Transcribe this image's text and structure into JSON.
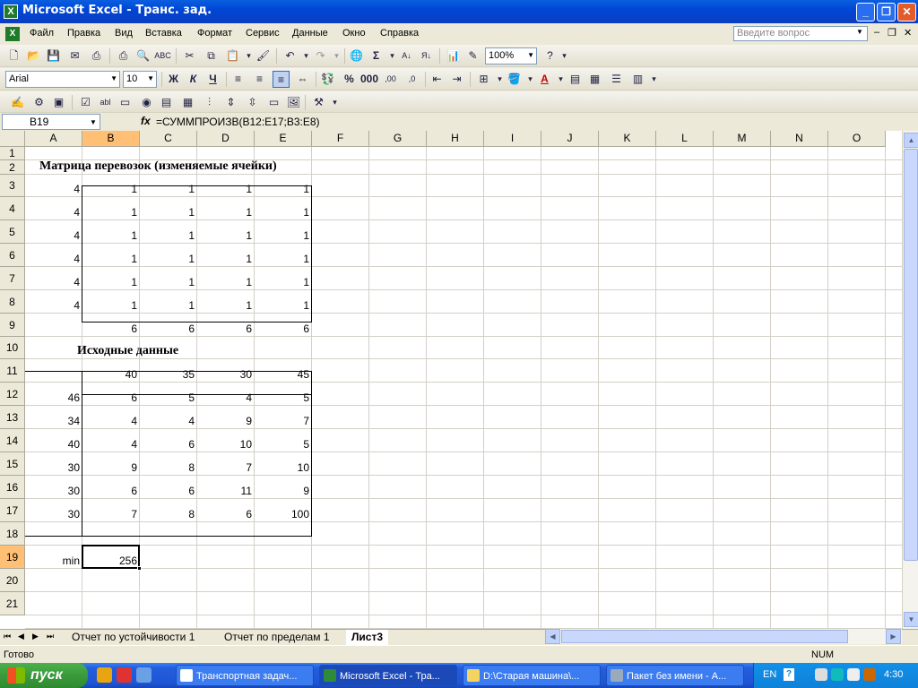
{
  "window": {
    "title": "Microsoft Excel - Транс. зад."
  },
  "menu": [
    "Файл",
    "Правка",
    "Вид",
    "Вставка",
    "Формат",
    "Сервис",
    "Данные",
    "Окно",
    "Справка"
  ],
  "ask_placeholder": "Введите вопрос",
  "toolbar": {
    "zoom": "100%",
    "font": "Arial",
    "size": "10",
    "bold": "Ж",
    "italic": "К",
    "underline": "Ч"
  },
  "formula_bar": {
    "cell_ref": "B19",
    "fx": "fx",
    "formula": "=СУММПРОИЗВ(B12:E17;B3:E8)"
  },
  "columns": [
    "A",
    "B",
    "C",
    "D",
    "E",
    "F",
    "G",
    "H",
    "I",
    "J",
    "K",
    "L",
    "M",
    "N",
    "O"
  ],
  "rows": [
    "1",
    "2",
    "3",
    "4",
    "5",
    "6",
    "7",
    "8",
    "9",
    "10",
    "11",
    "12",
    "13",
    "14",
    "15",
    "16",
    "17",
    "18",
    "19",
    "20",
    "21"
  ],
  "cells": {
    "title1": "Матрица перевозок (изменяемые ячейки)",
    "title2": "Исходные данные",
    "min_label": "min",
    "min_value": "256",
    "matrix_rows": [
      [
        "4",
        "1",
        "1",
        "1",
        "1"
      ],
      [
        "4",
        "1",
        "1",
        "1",
        "1"
      ],
      [
        "4",
        "1",
        "1",
        "1",
        "1"
      ],
      [
        "4",
        "1",
        "1",
        "1",
        "1"
      ],
      [
        "4",
        "1",
        "1",
        "1",
        "1"
      ],
      [
        "4",
        "1",
        "1",
        "1",
        "1"
      ]
    ],
    "matrix_sums": [
      "6",
      "6",
      "6",
      "6"
    ],
    "demand": [
      "40",
      "35",
      "30",
      "45"
    ],
    "data_rows": [
      [
        "46",
        "6",
        "5",
        "4",
        "5"
      ],
      [
        "34",
        "4",
        "4",
        "9",
        "7"
      ],
      [
        "40",
        "4",
        "6",
        "10",
        "5"
      ],
      [
        "30",
        "9",
        "8",
        "7",
        "10"
      ],
      [
        "30",
        "6",
        "6",
        "11",
        "9"
      ],
      [
        "30",
        "7",
        "8",
        "6",
        "100"
      ]
    ]
  },
  "sheet_tabs": [
    "Отчет по устойчивости 1",
    "Отчет по пределам 1",
    "Лист3"
  ],
  "status": {
    "ready": "Готово",
    "num": "NUM"
  },
  "taskbar": {
    "start": "пуск",
    "items": [
      "Транспортная задач...",
      "Microsoft Excel - Тра...",
      "D:\\Старая машина\\...",
      "Пакет без имени - А..."
    ],
    "lang": "EN",
    "clock": "4:30"
  }
}
